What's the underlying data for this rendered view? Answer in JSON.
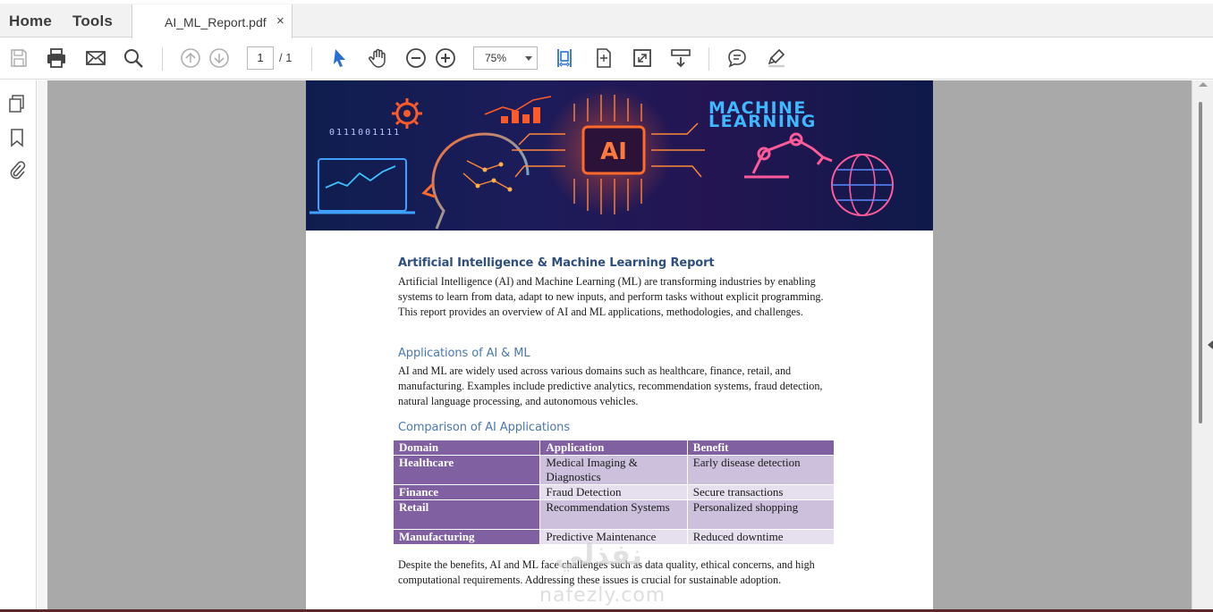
{
  "nav": {
    "home": "Home",
    "tools": "Tools"
  },
  "tab": {
    "title": "AI_ML_Report.pdf",
    "close": "×"
  },
  "toolbar": {
    "page_current": "1",
    "page_total": "/ 1",
    "zoom": "75%"
  },
  "banner": {
    "line1": "MACHINE",
    "line2": "LEARNING",
    "chip": "AI",
    "binary": "0111001111"
  },
  "report": {
    "title": "Artificial Intelligence & Machine Learning Report",
    "intro": "Artificial Intelligence (AI) and Machine Learning (ML) are transforming industries by enabling systems to learn from data, adapt to new inputs, and perform tasks without explicit programming. This report provides an overview of AI and ML applications, methodologies, and challenges.",
    "apps_heading": "Applications of AI & ML",
    "apps_text": "AI and ML are widely used across various domains such as healthcare, finance, retail, and manufacturing. Examples include predictive analytics, recommendation systems, fraud detection, natural language processing, and autonomous vehicles.",
    "comparison_heading": "Comparison of AI Applications",
    "table": {
      "headers": [
        "Domain",
        "Application",
        "Benefit"
      ],
      "rows": [
        [
          "Healthcare",
          "Medical Imaging & Diagnostics",
          "Early disease detection"
        ],
        [
          "Finance",
          "Fraud Detection",
          "Secure transactions"
        ],
        [
          "Retail",
          "Recommendation Systems",
          "Personalized shopping"
        ],
        [
          "Manufacturing",
          "Predictive Maintenance",
          "Reduced downtime"
        ]
      ]
    },
    "closing": "Despite the benefits, AI and ML face challenges such as data quality, ethical concerns, and high computational requirements. Addressing these issues is crucial for sustainable adoption."
  },
  "watermark": {
    "arabic": "نفذلي",
    "latin": "nafezly.com"
  }
}
